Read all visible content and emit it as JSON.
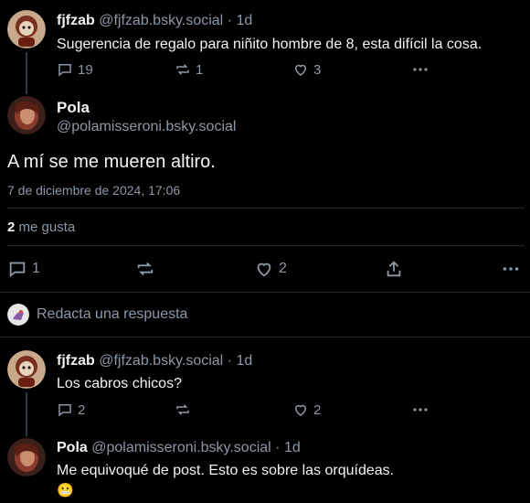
{
  "posts": [
    {
      "display_name": "fjfzab",
      "handle": "@fjfzab.bsky.social",
      "dot": "·",
      "age": "1d",
      "text": "Sugerencia de regalo para niñito hombre de 8, esta difícil la cosa.",
      "replies": "19",
      "reposts": "1",
      "likes": "3"
    }
  ],
  "focused_post": {
    "display_name": "Pola",
    "handle": "@polamisseroni.bsky.social",
    "text": "A mí se me mueren altiro.",
    "timestamp": "7 de diciembre de 2024, 17:06",
    "like_count": "2",
    "like_label": "me gusta",
    "replies": "1",
    "likes": "2"
  },
  "composer": {
    "placeholder": "Redacta una respuesta"
  },
  "replies": [
    {
      "display_name": "fjfzab",
      "handle": "@fjfzab.bsky.social",
      "dot": "·",
      "age": "1d",
      "text": "Los cabros chicos?",
      "replies": "2",
      "likes": "2"
    },
    {
      "display_name": "Pola",
      "handle": "@polamisseroni.bsky.social",
      "dot": "·",
      "age": "1d",
      "text": "Me equivoqué de post. Esto es sobre las orquídeas.",
      "emoji": "😬"
    }
  ],
  "icons": [
    "reply-icon",
    "repost-icon",
    "like-icon",
    "share-icon",
    "more-icon"
  ],
  "colors": {
    "background": "#000000",
    "text": "#f1f3f5",
    "muted": "#8b98a5",
    "divider": "#1f2a35"
  }
}
